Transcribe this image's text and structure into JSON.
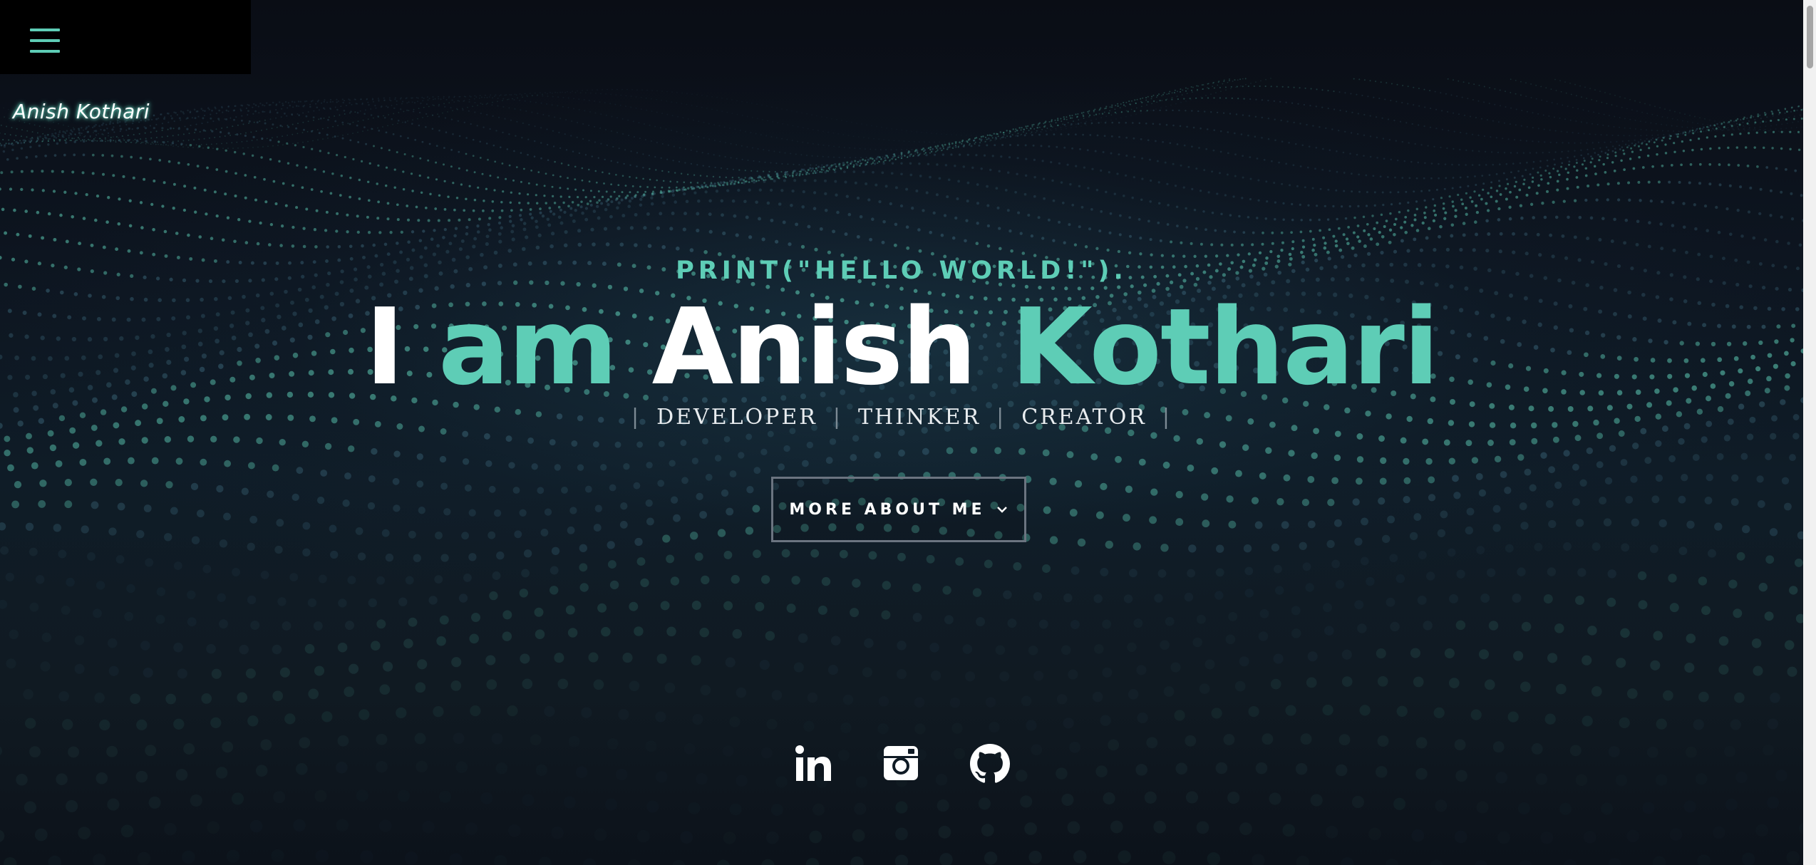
{
  "nav": {
    "menu_icon": "hamburger-menu-icon",
    "brand": "Anish Kothari"
  },
  "hero": {
    "intro": "PRINT(\"HELLO WORLD!\").",
    "headline": {
      "word1": "I",
      "word2": "am",
      "word3": "Anish",
      "word4": "Kothari"
    },
    "roles": [
      "DEVELOPER",
      "THINKER",
      "CREATOR"
    ],
    "cta_label": "MORE ABOUT ME"
  },
  "social": [
    {
      "name": "LinkedIn",
      "icon": "linkedin-icon"
    },
    {
      "name": "Instagram",
      "icon": "instagram-icon"
    },
    {
      "name": "GitHub",
      "icon": "github-icon"
    }
  ],
  "colors": {
    "accent": "#5ecdb6",
    "background": "#0b0f17",
    "text": "#ffffff"
  }
}
